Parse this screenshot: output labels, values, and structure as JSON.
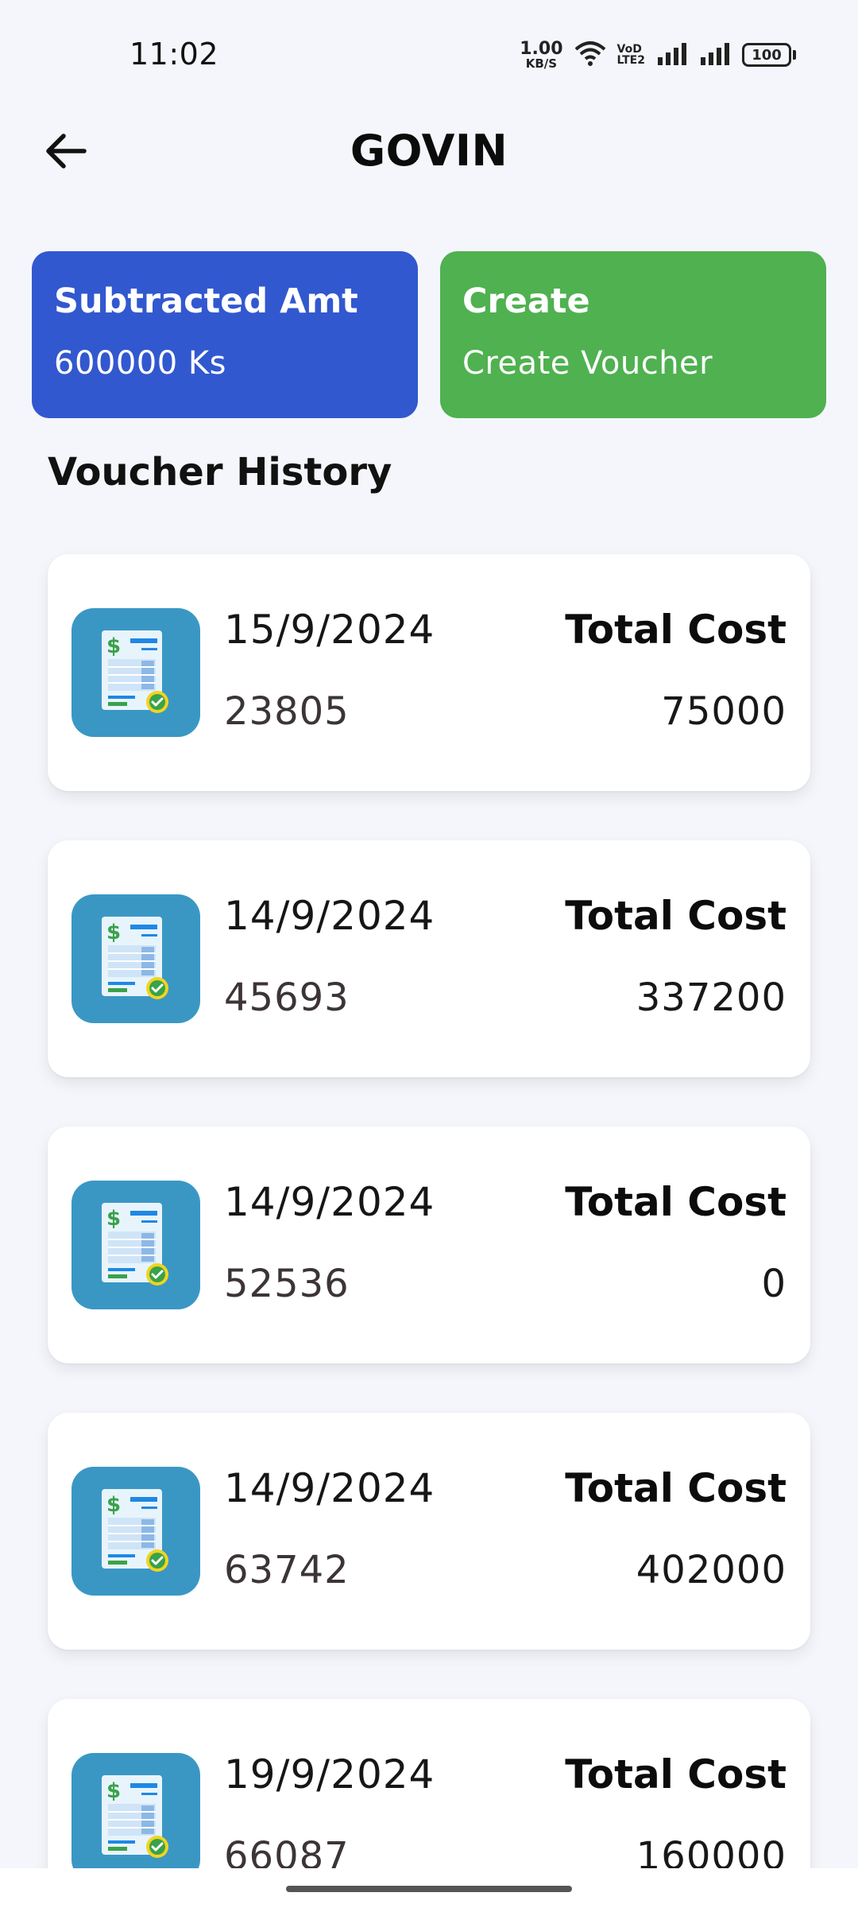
{
  "status_bar": {
    "time": "11:02",
    "net_speed_value": "1.00",
    "net_speed_unit": "KB/S",
    "volte_top": "VoD",
    "volte_bottom": "LTE2",
    "battery": "100"
  },
  "header": {
    "title": "GOVIN"
  },
  "actions": {
    "subtracted": {
      "title": "Subtracted Amt",
      "value": "600000 Ks",
      "color": "#3258cf"
    },
    "create": {
      "title": "Create",
      "subtitle": "Create Voucher",
      "color": "#4fb150"
    }
  },
  "section_title": "Voucher History",
  "vouchers": [
    {
      "date": "15/9/2024",
      "id": "23805",
      "total_label": "Total Cost",
      "total": "75000"
    },
    {
      "date": "14/9/2024",
      "id": "45693",
      "total_label": "Total Cost",
      "total": "337200"
    },
    {
      "date": "14/9/2024",
      "id": "52536",
      "total_label": "Total Cost",
      "total": "0"
    },
    {
      "date": "14/9/2024",
      "id": "63742",
      "total_label": "Total Cost",
      "total": "402000"
    },
    {
      "date": "19/9/2024",
      "id": "66087",
      "total_label": "Total Cost",
      "total": "160000"
    }
  ],
  "icons": {
    "back": "arrow-left-icon",
    "voucher": "receipt-dollar-check-icon"
  }
}
